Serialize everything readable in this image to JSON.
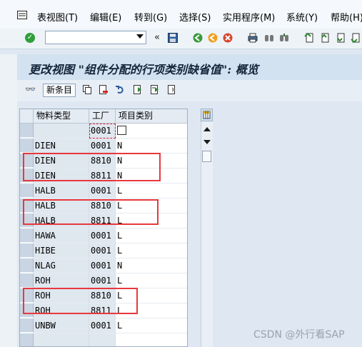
{
  "menu": {
    "items": [
      "表视图(T)",
      "编辑(E)",
      "转到(G)",
      "选择(S)",
      "实用程序(M)",
      "系统(Y)",
      "帮助(H)"
    ]
  },
  "toolbar": {
    "command_value": "",
    "back_glyph": "«"
  },
  "screen": {
    "title": "更改视图 \"组件分配的行项类别缺省值\": 概览",
    "new_entries_label": "新条目"
  },
  "table": {
    "headers": [
      "物料类型",
      "工厂",
      "项目类别"
    ],
    "rows": [
      {
        "mat": "",
        "plant": "0001",
        "cat": ""
      },
      {
        "mat": "DIEN",
        "plant": "0001",
        "cat": "N"
      },
      {
        "mat": "DIEN",
        "plant": "8810",
        "cat": "N"
      },
      {
        "mat": "DIEN",
        "plant": "8811",
        "cat": "N"
      },
      {
        "mat": "HALB",
        "plant": "0001",
        "cat": "L"
      },
      {
        "mat": "HALB",
        "plant": "8810",
        "cat": "L"
      },
      {
        "mat": "HALB",
        "plant": "8811",
        "cat": "L"
      },
      {
        "mat": "HAWA",
        "plant": "0001",
        "cat": "L"
      },
      {
        "mat": "HIBE",
        "plant": "0001",
        "cat": "L"
      },
      {
        "mat": "NLAG",
        "plant": "0001",
        "cat": "N"
      },
      {
        "mat": "ROH",
        "plant": "0001",
        "cat": "L"
      },
      {
        "mat": "ROH",
        "plant": "8810",
        "cat": "L"
      },
      {
        "mat": "ROH",
        "plant": "8811",
        "cat": "L"
      },
      {
        "mat": "UNBW",
        "plant": "0001",
        "cat": "L"
      },
      {
        "mat": "",
        "plant": "",
        "cat": ""
      }
    ]
  },
  "watermark": "CSDN @外行看SAP",
  "colors": {
    "highlight": "#e8383d",
    "ok": "#2f9f3a"
  }
}
